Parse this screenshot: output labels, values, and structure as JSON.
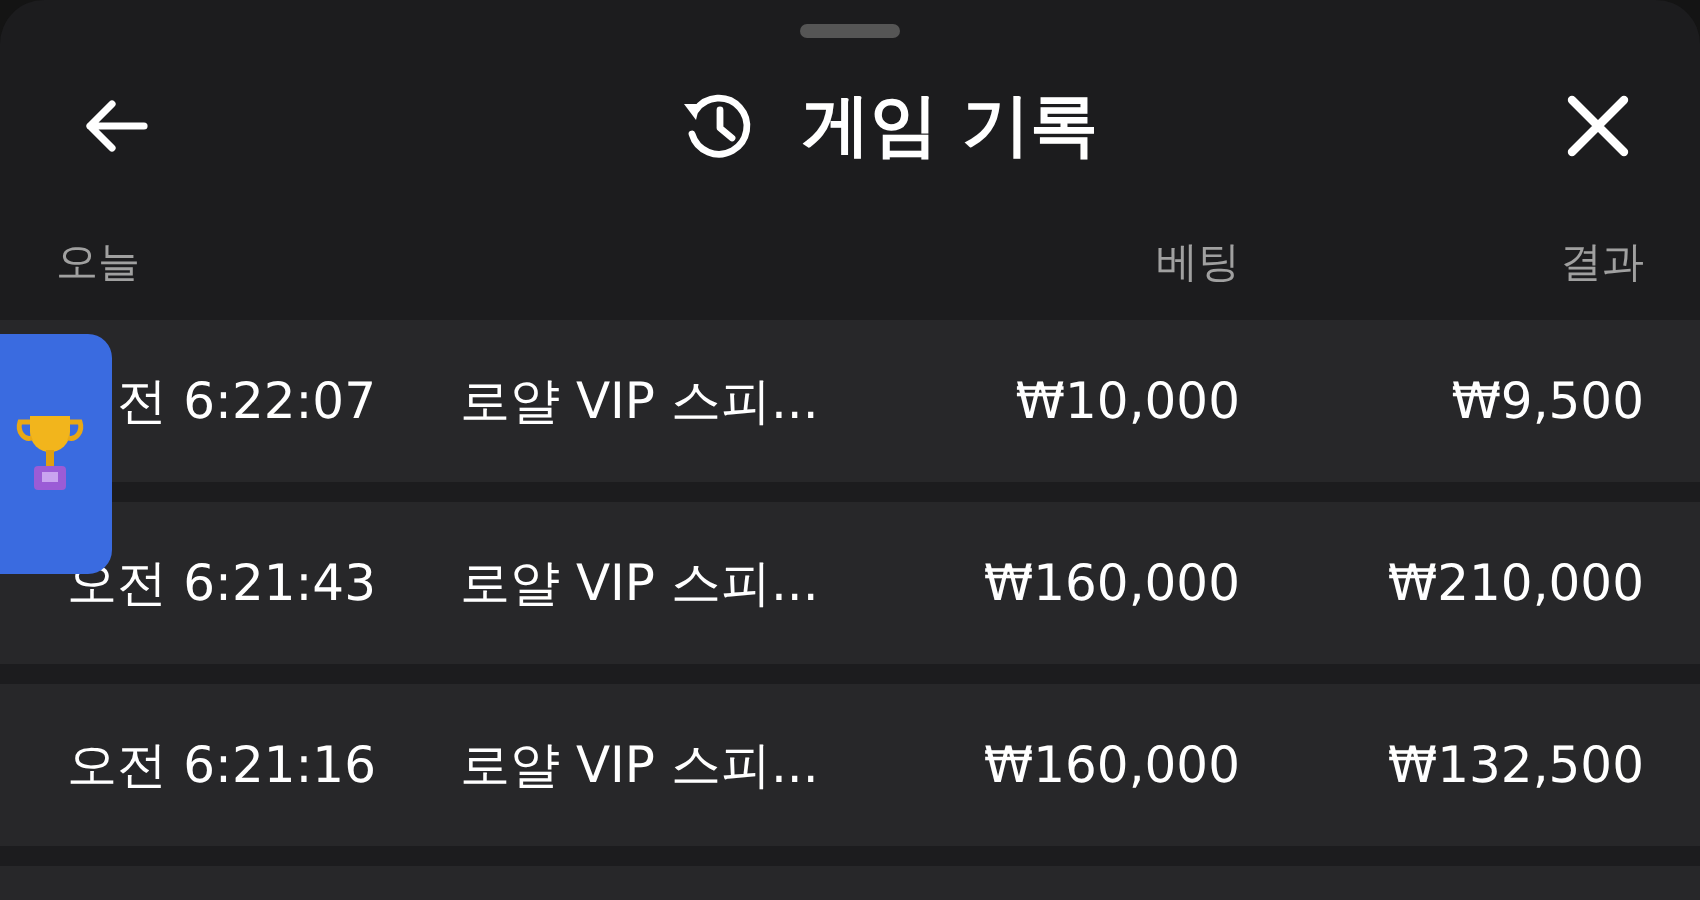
{
  "header": {
    "title": "게임 기록"
  },
  "table": {
    "columns": [
      "오늘",
      "베팅",
      "결과"
    ],
    "rows": [
      {
        "time": "전 6:22:07",
        "game": "로얄 VIP 스피...",
        "bet": "₩10,000",
        "result": "₩9,500"
      },
      {
        "time": "오전 6:21:43",
        "game": "로얄 VIP 스피...",
        "bet": "₩160,000",
        "result": "₩210,000"
      },
      {
        "time": "오전 6:21:16",
        "game": "로얄 VIP 스피...",
        "bet": "₩160,000",
        "result": "₩132,500"
      }
    ]
  }
}
